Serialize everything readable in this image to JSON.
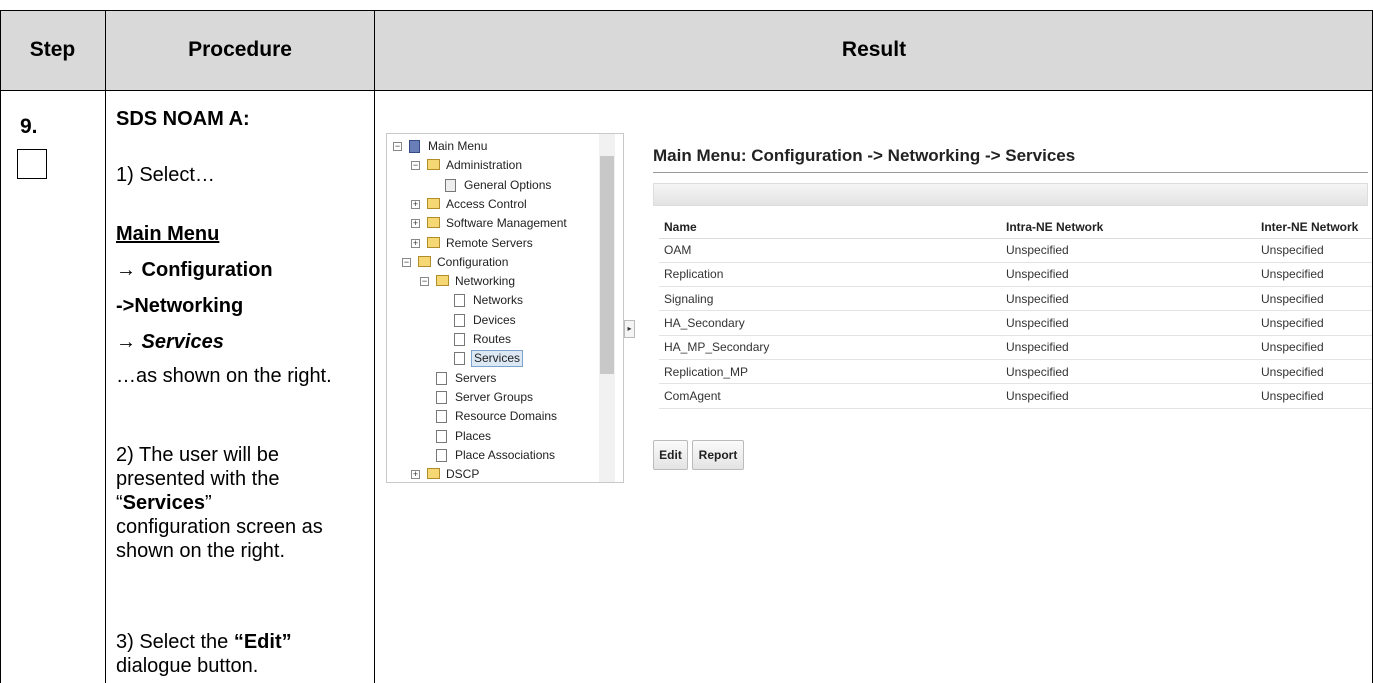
{
  "headers": {
    "step": "Step",
    "procedure": "Procedure",
    "result": "Result"
  },
  "step_number": "9.",
  "procedure": {
    "heading": "SDS NOAM A:",
    "p1": "1) Select…",
    "menu_main": "Main Menu",
    "menu_config": "→ Configuration",
    "menu_networking": "->Networking",
    "menu_services": "→ Services",
    "shown_text": "…as shown on the right.",
    "p2_a": "2) The user will be presented with the",
    "p2_quote_open": "“",
    "p2_bold": "Services",
    "p2_quote_close": "”",
    "p2_b": "configuration screen as shown on the right.",
    "p3_a": "3) Select the ",
    "p3_bold": "“Edit”",
    "p3_b": "dialogue button."
  },
  "tree": {
    "items": [
      {
        "label": "Main Menu",
        "level": 0,
        "icon": "computer-icon",
        "expander": "−"
      },
      {
        "label": "Administration",
        "level": 1,
        "icon": "open-folder-icon",
        "expander": "−"
      },
      {
        "label": "General Options",
        "level": 2,
        "icon": "options-icon",
        "expander": ""
      },
      {
        "label": "Access Control",
        "level": 1,
        "icon": "folder-icon",
        "expander": "+"
      },
      {
        "label": "Software Management",
        "level": 1,
        "icon": "folder-icon",
        "expander": "+"
      },
      {
        "label": "Remote Servers",
        "level": 1,
        "icon": "folder-icon",
        "expander": "+"
      },
      {
        "label": "Configuration",
        "level": 0.5,
        "icon": "open-folder-icon",
        "expander": "−"
      },
      {
        "label": "Networking",
        "level": 1.5,
        "icon": "open-folder-icon",
        "expander": "−"
      },
      {
        "label": "Networks",
        "level": 2.5,
        "icon": "page-icon",
        "expander": ""
      },
      {
        "label": "Devices",
        "level": 2.5,
        "icon": "page-icon",
        "expander": ""
      },
      {
        "label": "Routes",
        "level": 2.5,
        "icon": "page-icon",
        "expander": ""
      },
      {
        "label": "Services",
        "level": 2.5,
        "icon": "page-icon",
        "expander": "",
        "selected": true
      },
      {
        "label": "Servers",
        "level": 1.5,
        "icon": "page-icon",
        "expander": ""
      },
      {
        "label": "Server Groups",
        "level": 1.5,
        "icon": "page-icon",
        "expander": ""
      },
      {
        "label": "Resource Domains",
        "level": 1.5,
        "icon": "page-icon",
        "expander": ""
      },
      {
        "label": "Places",
        "level": 1.5,
        "icon": "page-icon",
        "expander": ""
      },
      {
        "label": "Place Associations",
        "level": 1.5,
        "icon": "page-icon",
        "expander": ""
      },
      {
        "label": "DSCP",
        "level": 1,
        "icon": "folder-icon",
        "expander": "+"
      }
    ]
  },
  "main": {
    "title": "Main Menu: Configuration -> Networking -> Services",
    "columns": [
      "Name",
      "Intra-NE Network",
      "Inter-NE Network"
    ],
    "rows": [
      [
        "OAM",
        "Unspecified",
        "Unspecified"
      ],
      [
        "Replication",
        "Unspecified",
        "Unspecified"
      ],
      [
        "Signaling",
        "Unspecified",
        "Unspecified"
      ],
      [
        "HA_Secondary",
        "Unspecified",
        "Unspecified"
      ],
      [
        "HA_MP_Secondary",
        "Unspecified",
        "Unspecified"
      ],
      [
        "Replication_MP",
        "Unspecified",
        "Unspecified"
      ],
      [
        "ComAgent",
        "Unspecified",
        "Unspecified"
      ]
    ],
    "edit_label": "Edit",
    "report_label": "Report"
  },
  "colors": {
    "header_bg": "#d9d9d9",
    "selected_bg": "#dde8f5",
    "selected_border": "#7da2ce"
  }
}
